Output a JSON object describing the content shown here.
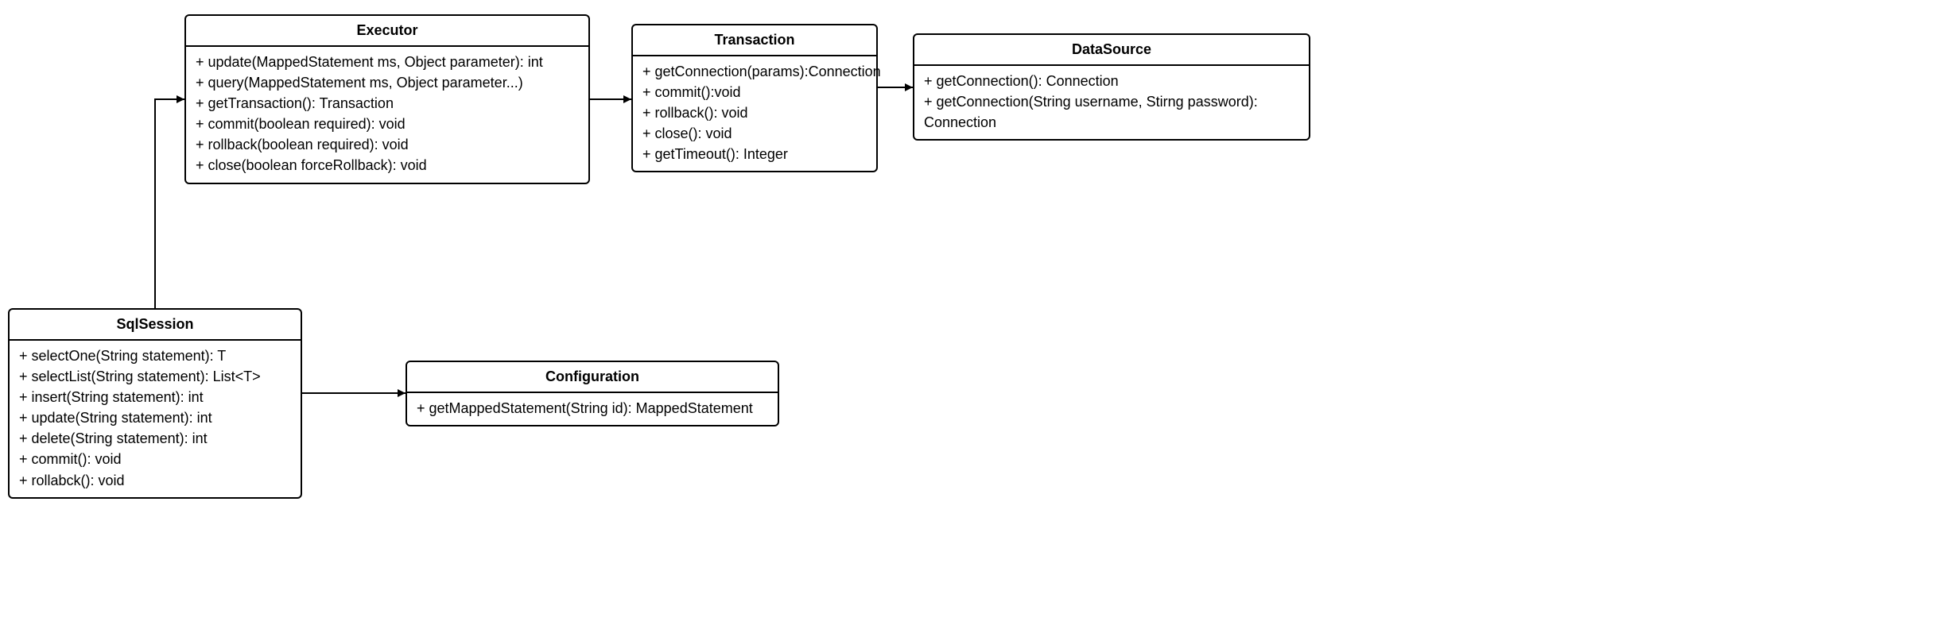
{
  "classes": {
    "sqlsession": {
      "title": "SqlSession",
      "members": [
        "+ selectOne(String statement): T",
        "+ selectList(String statement): List<T>",
        "+ insert(String statement): int",
        "+ update(String statement): int",
        "+ delete(String statement): int",
        "+ commit(): void",
        "+ rollabck(): void"
      ]
    },
    "executor": {
      "title": "Executor",
      "members": [
        "+ update(MappedStatement ms, Object parameter): int",
        "+ query(MappedStatement ms, Object parameter...)",
        "+ getTransaction(): Transaction",
        "+ commit(boolean required): void",
        "+ rollback(boolean required): void",
        "+ close(boolean forceRollback): void"
      ]
    },
    "transaction": {
      "title": "Transaction",
      "members": [
        "+ getConnection(params):Connection",
        "+ commit():void",
        "+ rollback(): void",
        "+ close(): void",
        "+ getTimeout(): Integer"
      ]
    },
    "datasource": {
      "title": "DataSource",
      "members": [
        "+ getConnection(): Connection",
        "+ getConnection(String username, Stirng password):",
        "Connection"
      ]
    },
    "configuration": {
      "title": "Configuration",
      "members": [
        "+ getMappedStatement(String id): MappedStatement"
      ]
    }
  }
}
